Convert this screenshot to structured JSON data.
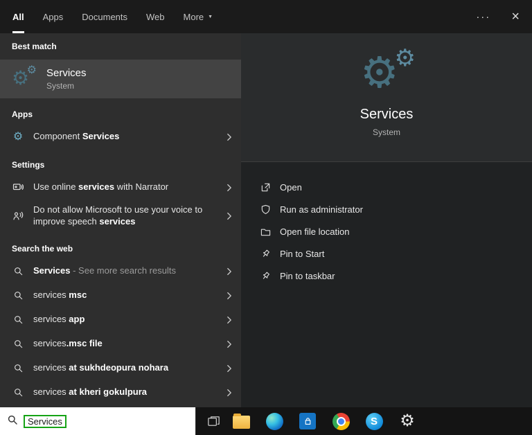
{
  "icons": {
    "gear": "⚙",
    "ellipsis": "···",
    "close": "×",
    "caret": "▼",
    "skype_letter": "S"
  },
  "tabs": {
    "items": [
      {
        "label": "All"
      },
      {
        "label": "Apps"
      },
      {
        "label": "Documents"
      },
      {
        "label": "Web"
      },
      {
        "label": "More"
      }
    ]
  },
  "sections": {
    "best_match": {
      "header": "Best match",
      "item": {
        "title": "Services",
        "subtitle": "System"
      }
    },
    "apps": {
      "header": "Apps",
      "items": [
        {
          "parts": [
            {
              "t": "Component ",
              "b": false
            },
            {
              "t": "Services",
              "b": true
            }
          ]
        }
      ]
    },
    "settings": {
      "header": "Settings",
      "items": [
        {
          "parts": [
            {
              "t": "Use online ",
              "b": false
            },
            {
              "t": "services",
              "b": true
            },
            {
              "t": " with Narrator",
              "b": false
            }
          ]
        },
        {
          "parts": [
            {
              "t": "Do not allow Microsoft to use your voice to improve speech ",
              "b": false
            },
            {
              "t": "services",
              "b": true
            }
          ]
        }
      ]
    },
    "web": {
      "header": "Search the web",
      "items": [
        {
          "parts": [
            {
              "t": "Services",
              "b": true
            },
            {
              "t": " - See more search results",
              "b": false,
              "muted": true
            }
          ]
        },
        {
          "parts": [
            {
              "t": "services ",
              "b": false
            },
            {
              "t": "msc",
              "b": true
            }
          ]
        },
        {
          "parts": [
            {
              "t": "services ",
              "b": false
            },
            {
              "t": "app",
              "b": true
            }
          ]
        },
        {
          "parts": [
            {
              "t": "services",
              "b": false
            },
            {
              "t": ".msc file",
              "b": true
            }
          ]
        },
        {
          "parts": [
            {
              "t": "services ",
              "b": false
            },
            {
              "t": "at sukhdeopura nohara",
              "b": true
            }
          ]
        },
        {
          "parts": [
            {
              "t": "services ",
              "b": false
            },
            {
              "t": "at kheri gokulpura",
              "b": true
            }
          ]
        }
      ]
    }
  },
  "preview": {
    "title": "Services",
    "subtitle": "System",
    "actions": [
      "Open",
      "Run as administrator",
      "Open file location",
      "Pin to Start",
      "Pin to taskbar"
    ]
  },
  "taskbar": {
    "search_value": "Services"
  }
}
